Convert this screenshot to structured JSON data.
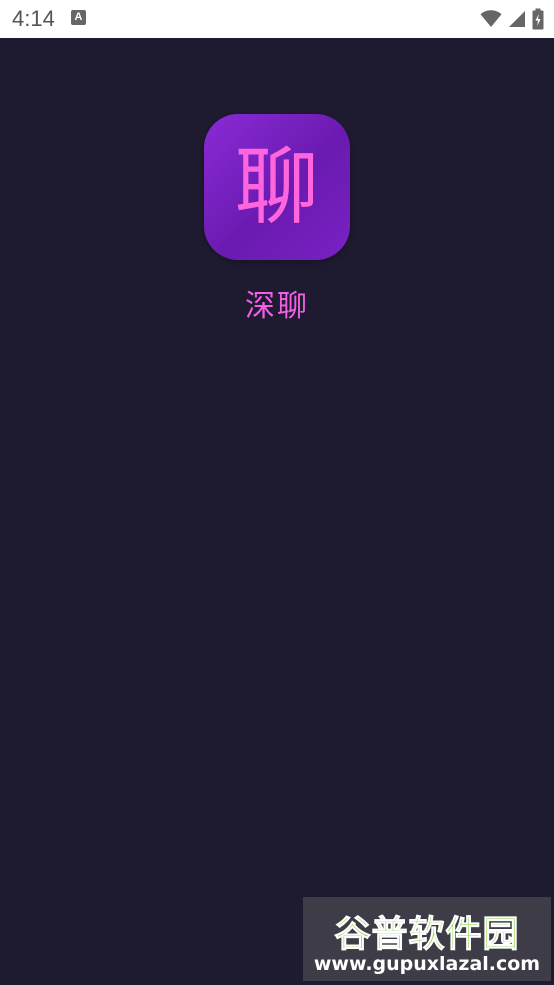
{
  "status_bar": {
    "time": "4:14",
    "notification_icon": "a-icon",
    "icons": [
      "wifi-icon",
      "signal-icon",
      "battery-icon"
    ],
    "background_color": "#ffffff"
  },
  "screen": {
    "background_color": "#1e1a30"
  },
  "app": {
    "icon_glyph": "聊",
    "icon_name": "app-logo-icon",
    "name": "深聊",
    "accent_color": "#f25fe7",
    "icon_gradient": [
      "#8a2bd6",
      "#6a1ab0"
    ]
  },
  "watermark": {
    "title": "谷普软件园",
    "url": "www.gupuxlazal.com"
  }
}
